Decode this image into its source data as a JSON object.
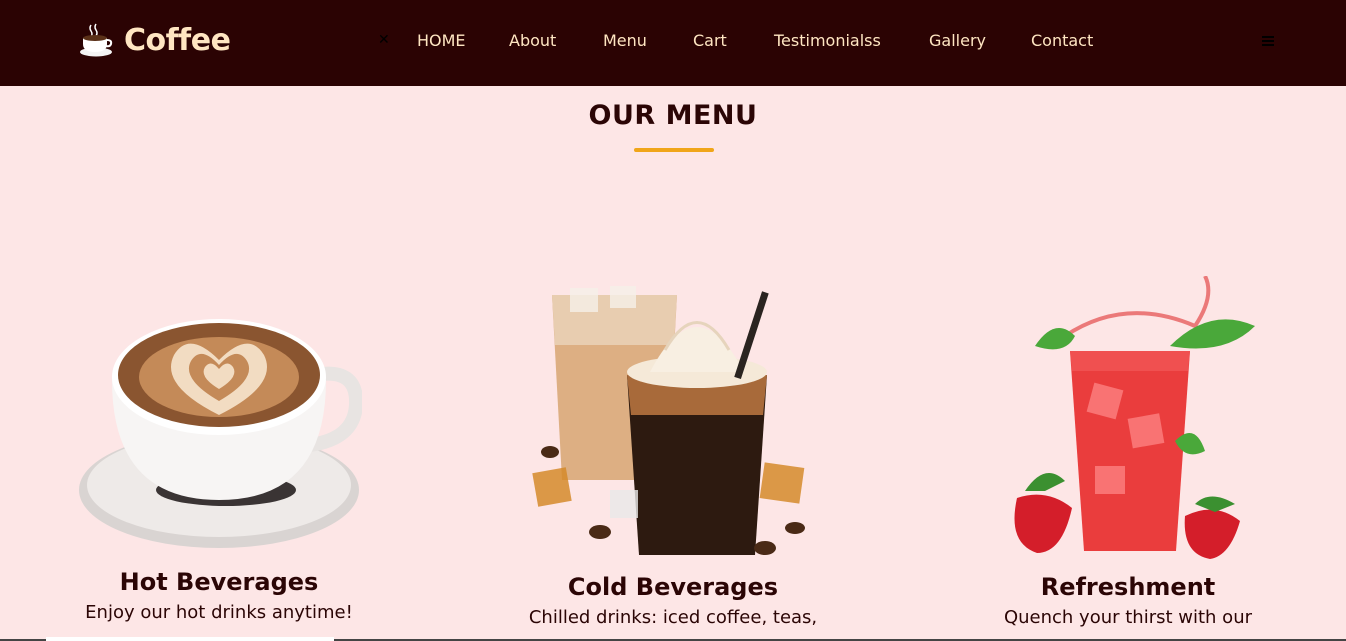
{
  "brand": {
    "name": "Coffee",
    "icon": "coffee-cup-icon"
  },
  "nav": {
    "items": [
      {
        "label": "HOME"
      },
      {
        "label": "About"
      },
      {
        "label": "Menu"
      },
      {
        "label": "Cart"
      },
      {
        "label": "Testimonialss"
      },
      {
        "label": "Gallery"
      },
      {
        "label": "Contact"
      }
    ]
  },
  "menu": {
    "title": "OUR MENU",
    "cards": [
      {
        "name": "Hot Beverages",
        "description": "Enjoy our hot drinks anytime!",
        "image": "coffee-cup-image"
      },
      {
        "name": "Cold Beverages",
        "description": "Chilled drinks: iced coffee, teas,",
        "image": "iced-drinks-image"
      },
      {
        "name": "Refreshment",
        "description": "Quench your thirst with our",
        "image": "strawberry-drink-image"
      }
    ]
  },
  "colors": {
    "header_bg": "#2b0303",
    "page_bg": "#fde6e6",
    "accent": "#f0a519",
    "nav_text": "#ffe6c2"
  }
}
